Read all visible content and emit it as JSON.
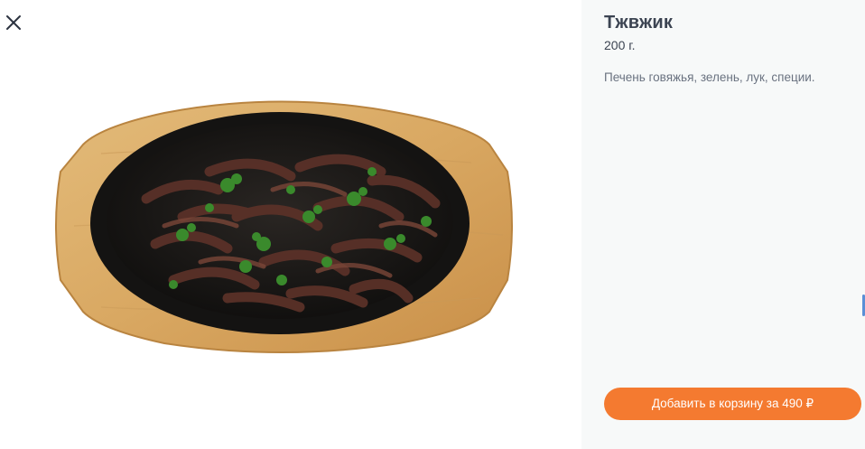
{
  "product": {
    "title": "Тжвжик",
    "weight": "200 г.",
    "description": "Печень говяжья, зелень, лук, специи.",
    "add_to_cart_label": "Добавить в корзину за 490 ₽"
  },
  "icons": {
    "close": "close-icon"
  },
  "colors": {
    "accent": "#f47a30",
    "title_text": "#3c4452",
    "description_text": "#6a7280",
    "info_background": "#f7f9f9"
  }
}
